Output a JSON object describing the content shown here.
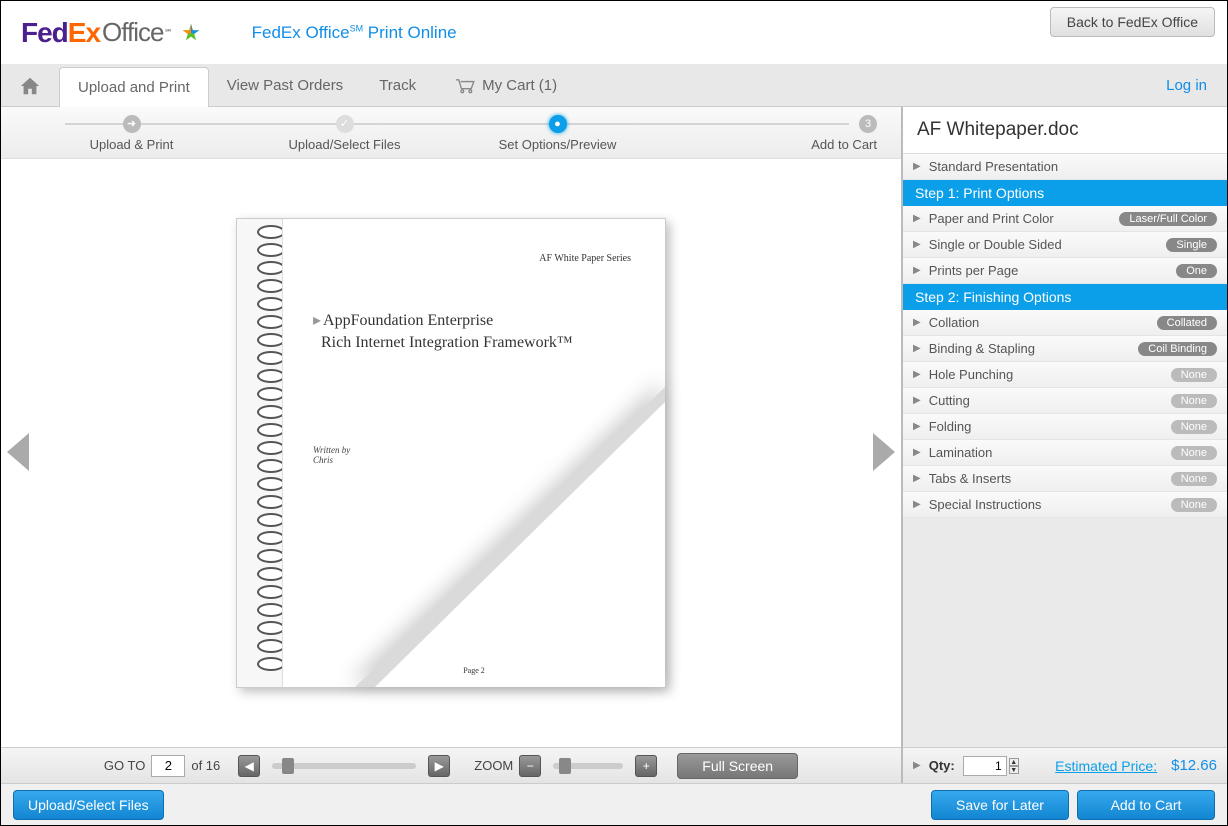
{
  "header": {
    "logo_fed": "Fed",
    "logo_ex": "Ex",
    "logo_office": "Office",
    "logo_tm": "℠",
    "brand_prefix": "FedEx Office",
    "brand_sm": "SM",
    "brand_suffix": " Print Online",
    "back_btn": "Back to FedEx Office"
  },
  "nav": {
    "tab_upload": "Upload and Print",
    "tab_past": "View Past Orders",
    "tab_track": "Track",
    "cart": "My Cart (1)",
    "login": "Log in"
  },
  "wizard": {
    "step1": "Upload & Print",
    "step2": "Upload/Select Files",
    "step3": "Set Options/Preview",
    "step4": "Add to Cart",
    "step4_num": "3"
  },
  "doc": {
    "series": "AF White Paper Series",
    "title_l1": "AppFoundation Enterprise",
    "title_l2": "Rich Internet Integration Framework™",
    "written": "Written by",
    "author": "Chris",
    "pagenum": "Page 2"
  },
  "pager": {
    "goto_label": "GO TO",
    "current_page": "2",
    "of_label": "of 16",
    "zoom_label": "ZOOM",
    "fullscreen": "Full Screen"
  },
  "sidebar": {
    "title": "AF Whitepaper.doc",
    "std_pres": "Standard Presentation",
    "step1_header": "Step 1: Print Options",
    "step2_header": "Step 2: Finishing Options",
    "opts": {
      "paper": {
        "label": "Paper and Print Color",
        "badge": "Laser/Full Color"
      },
      "sides": {
        "label": "Single or Double Sided",
        "badge": "Single"
      },
      "prints": {
        "label": "Prints per Page",
        "badge": "One"
      },
      "collation": {
        "label": "Collation",
        "badge": "Collated"
      },
      "binding": {
        "label": "Binding & Stapling",
        "badge": "Coil Binding"
      },
      "hole": {
        "label": "Hole Punching",
        "badge": "None"
      },
      "cutting": {
        "label": "Cutting",
        "badge": "None"
      },
      "folding": {
        "label": "Folding",
        "badge": "None"
      },
      "lam": {
        "label": "Lamination",
        "badge": "None"
      },
      "tabs": {
        "label": "Tabs & Inserts",
        "badge": "None"
      },
      "special": {
        "label": "Special Instructions",
        "badge": "None"
      }
    },
    "qty_label": "Qty:",
    "qty_value": "1",
    "est_label": "Estimated Price:",
    "est_price": "$12.66"
  },
  "footer": {
    "upload": "Upload/Select Files",
    "save": "Save for Later",
    "add": "Add to Cart"
  }
}
